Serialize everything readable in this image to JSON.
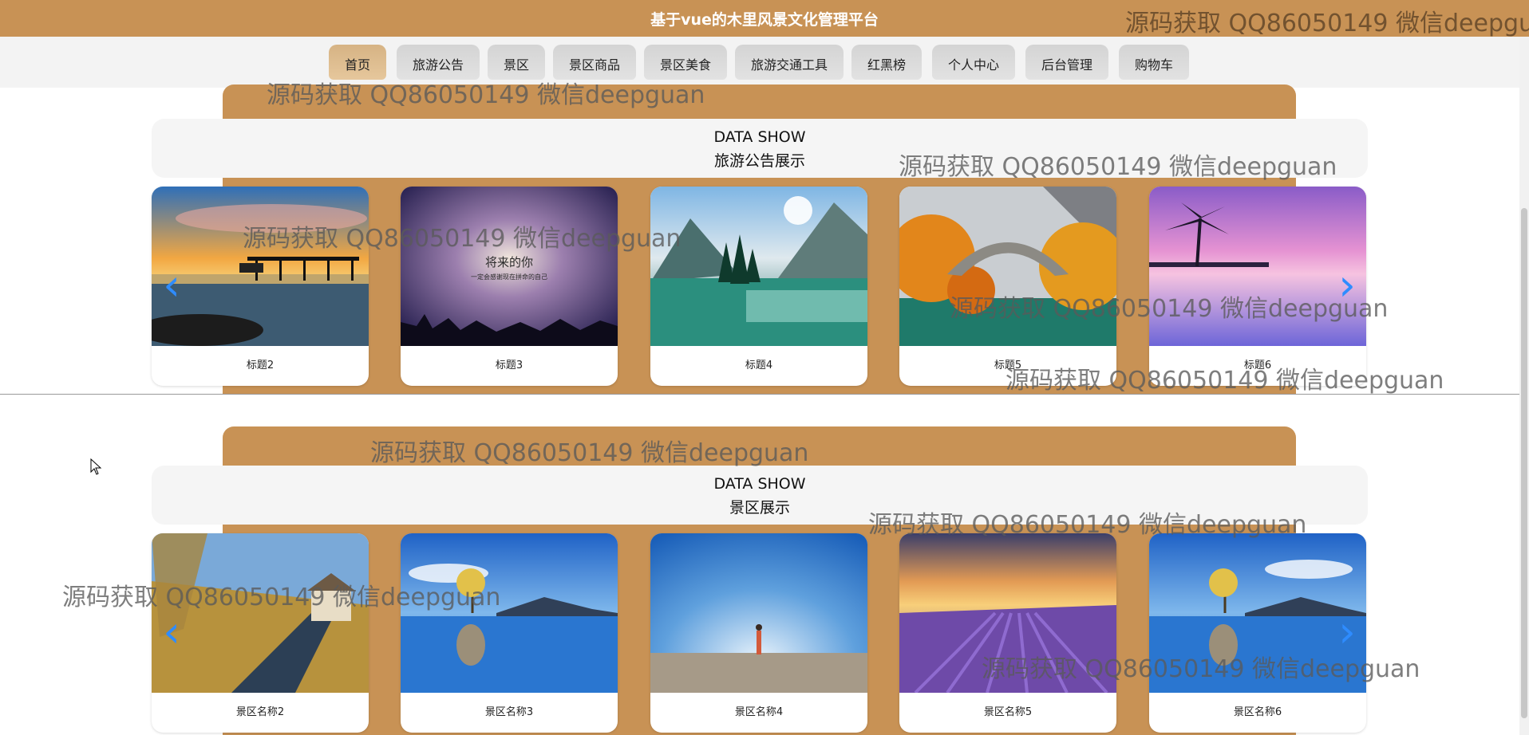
{
  "header": {
    "title": "基于vue的木里风景文化管理平台"
  },
  "nav": {
    "items": [
      {
        "label": "首页",
        "active": true
      },
      {
        "label": "旅游公告"
      },
      {
        "label": "景区"
      },
      {
        "label": "景区商品"
      },
      {
        "label": "景区美食"
      },
      {
        "label": "旅游交通工具"
      },
      {
        "label": "红黑榜"
      },
      {
        "label": "个人中心"
      },
      {
        "label": "后台管理"
      },
      {
        "label": "购物车"
      }
    ]
  },
  "sections": [
    {
      "en": "DATA SHOW",
      "zh": "旅游公告展示",
      "cards": [
        {
          "caption": "标题2",
          "scene": "sunset-pier"
        },
        {
          "caption": "标题3",
          "scene": "purple-night-text"
        },
        {
          "caption": "标题4",
          "scene": "mountain-lake"
        },
        {
          "caption": "标题5",
          "scene": "autumn-bridge"
        },
        {
          "caption": "标题6",
          "scene": "pink-palm"
        }
      ]
    },
    {
      "en": "DATA SHOW",
      "zh": "景区展示",
      "cards": [
        {
          "caption": "景区名称2",
          "scene": "country-road"
        },
        {
          "caption": "景区名称3",
          "scene": "lone-tree-lake"
        },
        {
          "caption": "景区名称4",
          "scene": "blue-horizon-person"
        },
        {
          "caption": "景区名称5",
          "scene": "lavender-field"
        },
        {
          "caption": "景区名称6",
          "scene": "lone-tree-lake"
        }
      ]
    }
  ],
  "poster_text": {
    "line1": "将来的你",
    "line2": "一定会感谢现在拼命的自己"
  },
  "watermark": "源码获取 QQ86050149 微信deepguan",
  "colors": {
    "brand": "#c89255",
    "arrow": "#2e8cff",
    "nav_active": "#d6b384"
  },
  "icons": {
    "prev": "chevron-left-icon",
    "next": "chevron-right-icon",
    "cursor": "mouse-pointer-icon"
  }
}
